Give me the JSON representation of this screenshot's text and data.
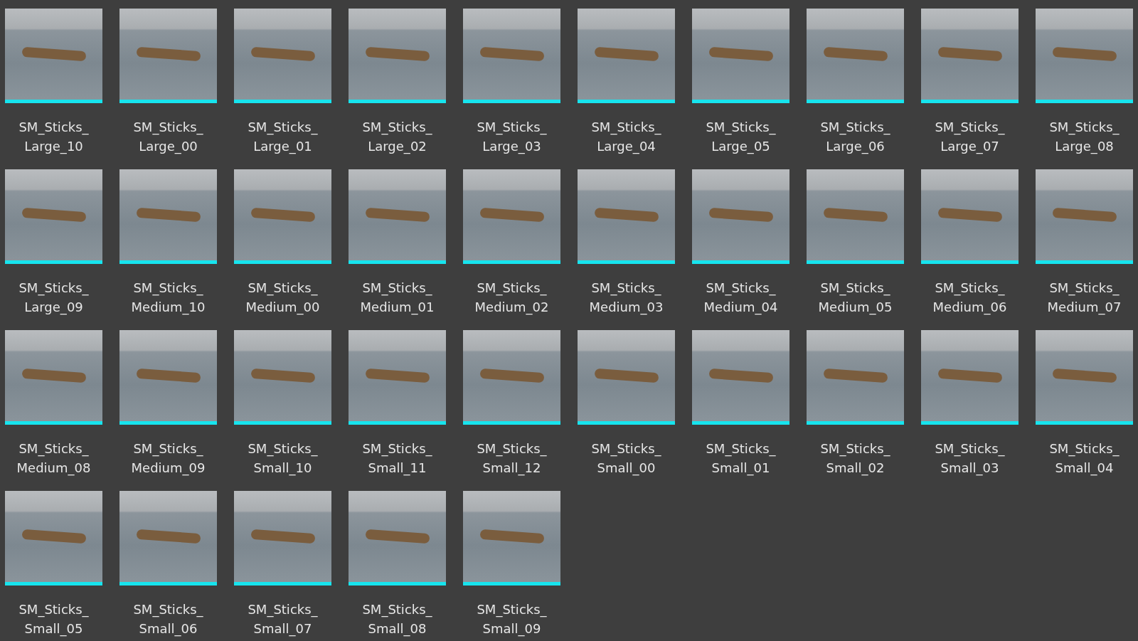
{
  "assets": [
    {
      "name": "SM_Sticks_Large_10"
    },
    {
      "name": "SM_Sticks_Large_00"
    },
    {
      "name": "SM_Sticks_Large_01"
    },
    {
      "name": "SM_Sticks_Large_02"
    },
    {
      "name": "SM_Sticks_Large_03"
    },
    {
      "name": "SM_Sticks_Large_04"
    },
    {
      "name": "SM_Sticks_Large_05"
    },
    {
      "name": "SM_Sticks_Large_06"
    },
    {
      "name": "SM_Sticks_Large_07"
    },
    {
      "name": "SM_Sticks_Large_08"
    },
    {
      "name": "SM_Sticks_Large_09"
    },
    {
      "name": "SM_Sticks_Medium_10"
    },
    {
      "name": "SM_Sticks_Medium_00"
    },
    {
      "name": "SM_Sticks_Medium_01"
    },
    {
      "name": "SM_Sticks_Medium_02"
    },
    {
      "name": "SM_Sticks_Medium_03"
    },
    {
      "name": "SM_Sticks_Medium_04"
    },
    {
      "name": "SM_Sticks_Medium_05"
    },
    {
      "name": "SM_Sticks_Medium_06"
    },
    {
      "name": "SM_Sticks_Medium_07"
    },
    {
      "name": "SM_Sticks_Medium_08"
    },
    {
      "name": "SM_Sticks_Medium_09"
    },
    {
      "name": "SM_Sticks_Small_10"
    },
    {
      "name": "SM_Sticks_Small_11"
    },
    {
      "name": "SM_Sticks_Small_12"
    },
    {
      "name": "SM_Sticks_Small_00"
    },
    {
      "name": "SM_Sticks_Small_01"
    },
    {
      "name": "SM_Sticks_Small_02"
    },
    {
      "name": "SM_Sticks_Small_03"
    },
    {
      "name": "SM_Sticks_Small_04"
    },
    {
      "name": "SM_Sticks_Small_05"
    },
    {
      "name": "SM_Sticks_Small_06"
    },
    {
      "name": "SM_Sticks_Small_07"
    },
    {
      "name": "SM_Sticks_Small_08"
    },
    {
      "name": "SM_Sticks_Small_09"
    }
  ]
}
